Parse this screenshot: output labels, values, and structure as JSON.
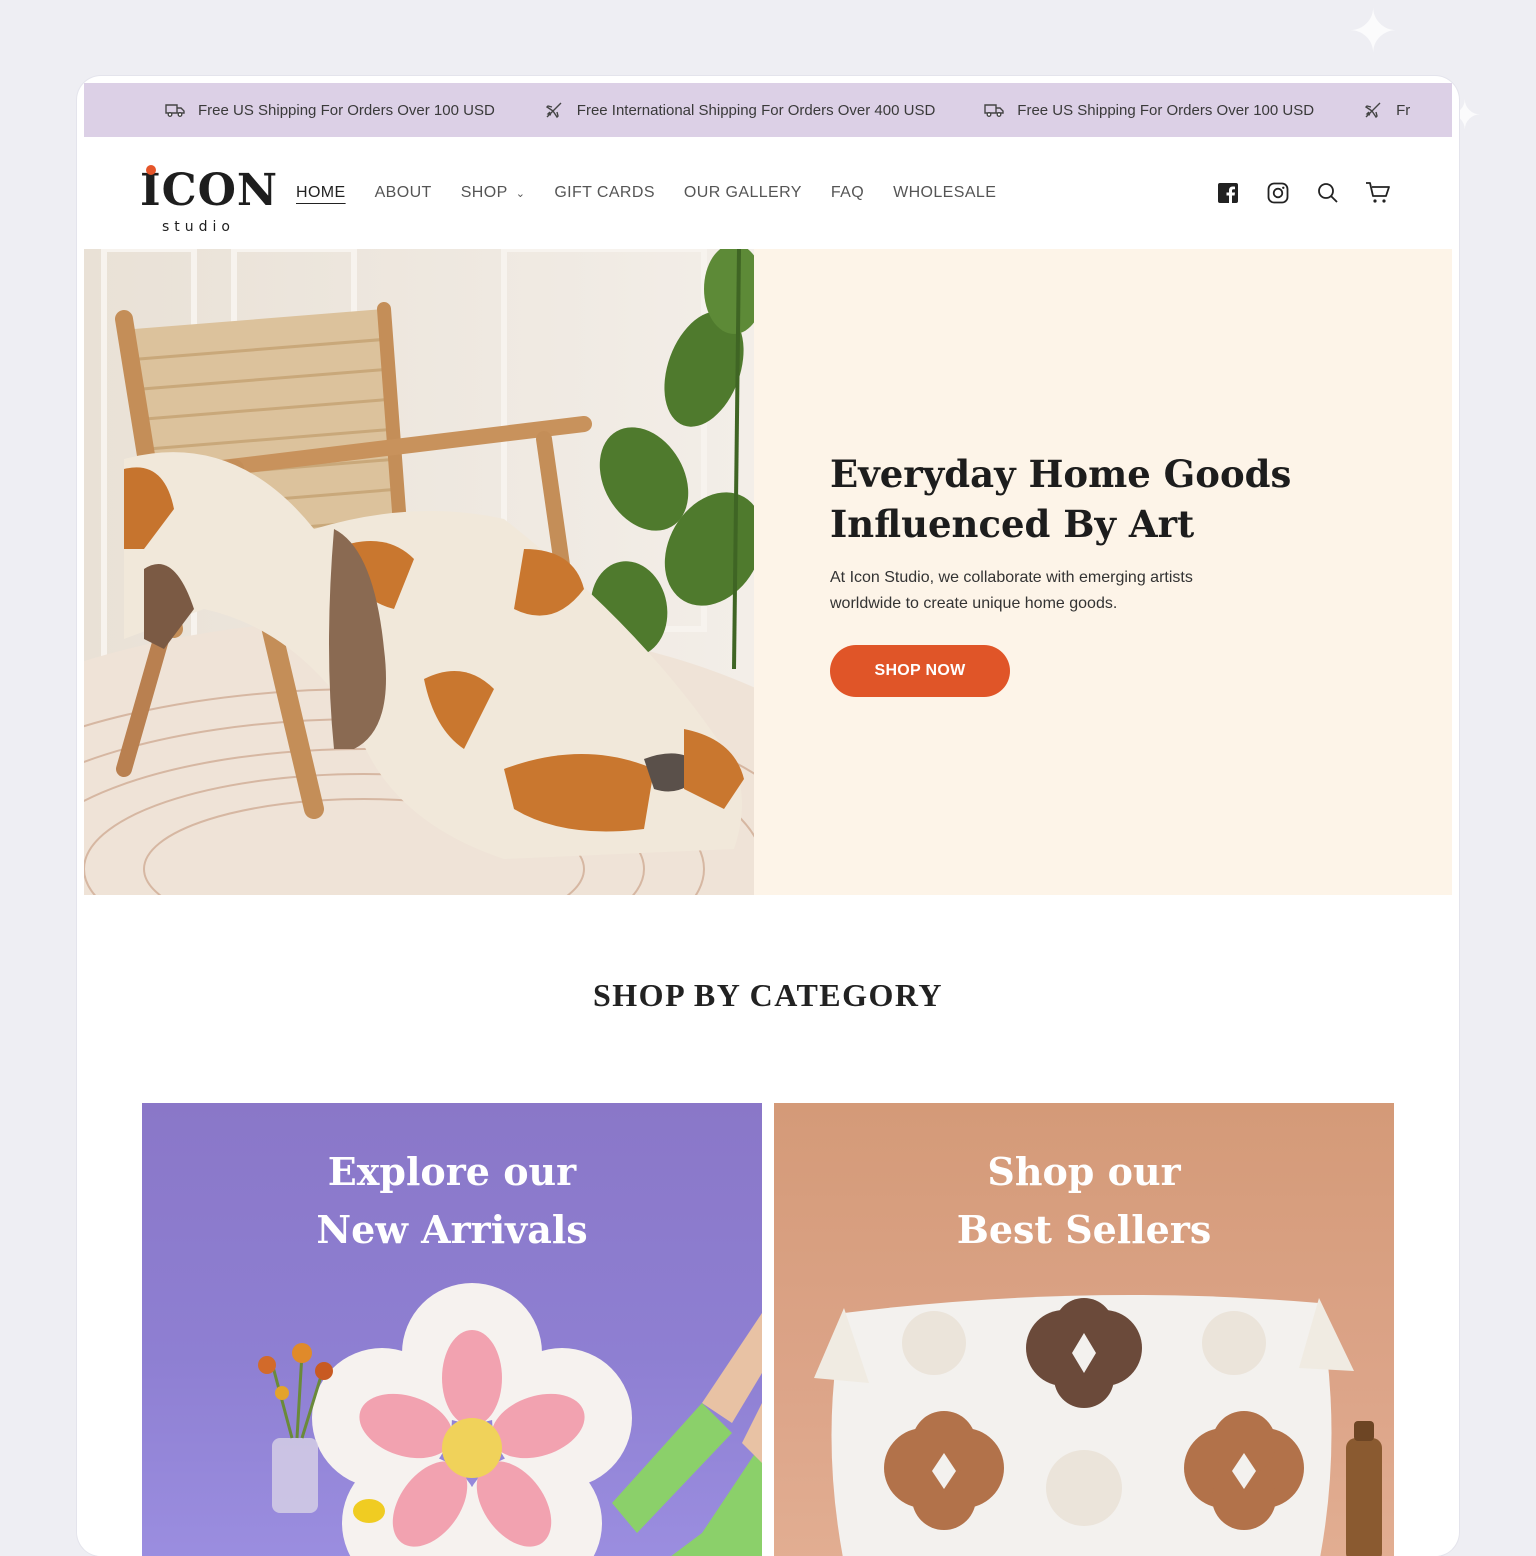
{
  "announcement": {
    "items": [
      {
        "icon": "truck-icon",
        "text": "Free US Shipping For Orders Over 100 USD"
      },
      {
        "icon": "plane-icon",
        "text": "Free International Shipping For Orders Over 400 USD"
      },
      {
        "icon": "truck-icon",
        "text": "Free US Shipping For Orders Over 100 USD"
      },
      {
        "icon": "plane-icon",
        "text": "Fr"
      }
    ]
  },
  "header": {
    "logo": {
      "mark": "ICON",
      "sub": "studio"
    },
    "nav": [
      {
        "label": "HOME",
        "active": true
      },
      {
        "label": "ABOUT"
      },
      {
        "label": "SHOP",
        "dropdown": true
      },
      {
        "label": "GIFT CARDS"
      },
      {
        "label": "OUR GALLERY"
      },
      {
        "label": "FAQ"
      },
      {
        "label": "WHOLESALE"
      }
    ],
    "icons": [
      "facebook-icon",
      "instagram-icon",
      "search-icon",
      "cart-icon"
    ]
  },
  "hero": {
    "title_line1": "Everyday Home Goods",
    "title_line2": "Influenced By Art",
    "description_line1": "At Icon Studio, we collaborate with emerging artists",
    "description_line2": "worldwide to create unique home goods.",
    "button": "SHOP NOW"
  },
  "category": {
    "title": "SHOP BY CATEGORY",
    "cards": [
      {
        "line1": "Explore our",
        "line2": "New Arrivals"
      },
      {
        "line1": "Shop our",
        "line2": "Best Sellers"
      }
    ]
  },
  "colors": {
    "announcement_bg": "#dcd0e6",
    "hero_text_bg": "#fdf4e8",
    "accent": "#e05528",
    "card_purple": "#8e7fd2",
    "card_peach": "#dca488"
  }
}
